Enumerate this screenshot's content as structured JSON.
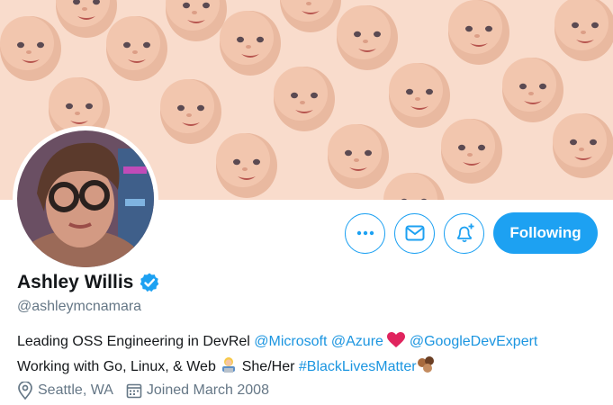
{
  "profile": {
    "name": "Ashley Willis",
    "handle": "@ashleymcnamara",
    "follow_label": "Following",
    "bio": {
      "line1_text": "Leading OSS Engineering in DevRel ",
      "mention1": "@Microsoft",
      "mention2": "@Azure",
      "mention3": "@GoogleDevExpert",
      "line2_text": "Working with Go, Linux, & Web ",
      "line2_after_emoji": " She/Her ",
      "hashtag": "#BlackLivesMatter"
    },
    "location": "Seattle, WA",
    "joined": "Joined March 2008"
  },
  "icons": {
    "more": "more-icon",
    "message": "mail-icon",
    "notifications": "bell-plus-icon",
    "verified": "verified-badge-icon",
    "location": "location-pin-icon",
    "calendar": "calendar-icon"
  },
  "colors": {
    "accent": "#1da1f2",
    "link": "#1b95e0",
    "secondary_text": "#657786",
    "banner_bg": "#f9dccc"
  }
}
